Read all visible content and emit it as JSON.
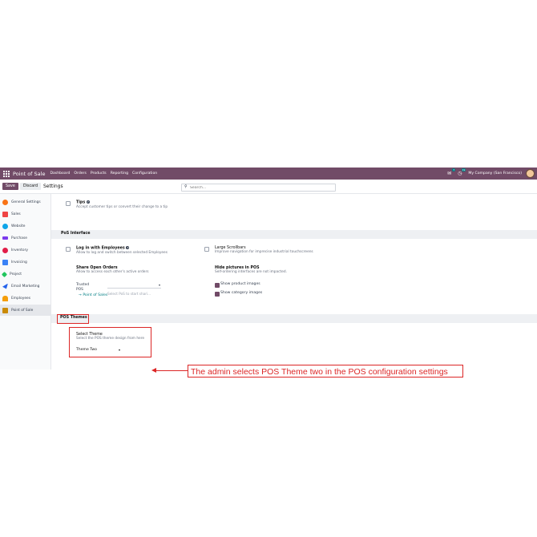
{
  "topnav": {
    "app_name": "Point of Sale",
    "menu": [
      "Dashboard",
      "Orders",
      "Products",
      "Reporting",
      "Configuration"
    ],
    "chat_count": "7",
    "activity_count": "19",
    "company": "My Company (San Francisco)"
  },
  "control": {
    "save_label": "Save",
    "discard_label": "Discard",
    "page_title": "Settings",
    "search_placeholder": "Search..."
  },
  "sidebar": {
    "items": [
      {
        "label": "General Settings",
        "icon": "general-settings-icon",
        "color": "#f97316"
      },
      {
        "label": "Sales",
        "icon": "sales-icon",
        "color": "#ef4444"
      },
      {
        "label": "Website",
        "icon": "website-icon",
        "color": "#0ea5e9"
      },
      {
        "label": "Purchase",
        "icon": "purchase-icon",
        "color": "#7c3aed"
      },
      {
        "label": "Inventory",
        "icon": "inventory-icon",
        "color": "#e11d48"
      },
      {
        "label": "Invoicing",
        "icon": "invoicing-icon",
        "color": "#3b82f6"
      },
      {
        "label": "Project",
        "icon": "project-icon",
        "color": "#22c55e"
      },
      {
        "label": "Email Marketing",
        "icon": "email-marketing-icon",
        "color": "#2563eb"
      },
      {
        "label": "Employees",
        "icon": "employees-icon",
        "color": "#f59e0b"
      },
      {
        "label": "Point of Sale",
        "icon": "point-of-sale-icon",
        "color": "#ca8a04"
      }
    ]
  },
  "settings": {
    "tips": {
      "title": "Tips",
      "desc": "Accept customer tips or convert their change to a tip"
    },
    "pos_interface_header": "PoS Interface",
    "login_employees": {
      "title": "Log in with Employees",
      "desc": "Allow to log and switch between selected Employees"
    },
    "large_scrollbars": {
      "title": "Large Scrollbars",
      "desc": "Improve navigation for imprecise industrial touchscreens"
    },
    "share_open_orders": {
      "title": "Share Open Orders",
      "desc": "Allow to access each other's active orders"
    },
    "trusted_pos_label": "Trusted POS",
    "trusted_pos_placeholder": "Select PoS to start shari...",
    "point_of_sales_link": "Point of Sales",
    "hide_pictures": {
      "title": "Hide pictures in POS",
      "desc": "Self-ordering interfaces are not impacted."
    },
    "show_product_images": "Show product images",
    "show_category_images": "Show category images",
    "pos_themes_header": "POS Themes",
    "select_theme": {
      "title": "Select Theme",
      "desc": "Select the POS theme design from here",
      "value": "Theme Two"
    }
  },
  "annotation": {
    "text": "The admin selects POS Theme two in the POS configuration settings",
    "color": "#dc2626"
  }
}
